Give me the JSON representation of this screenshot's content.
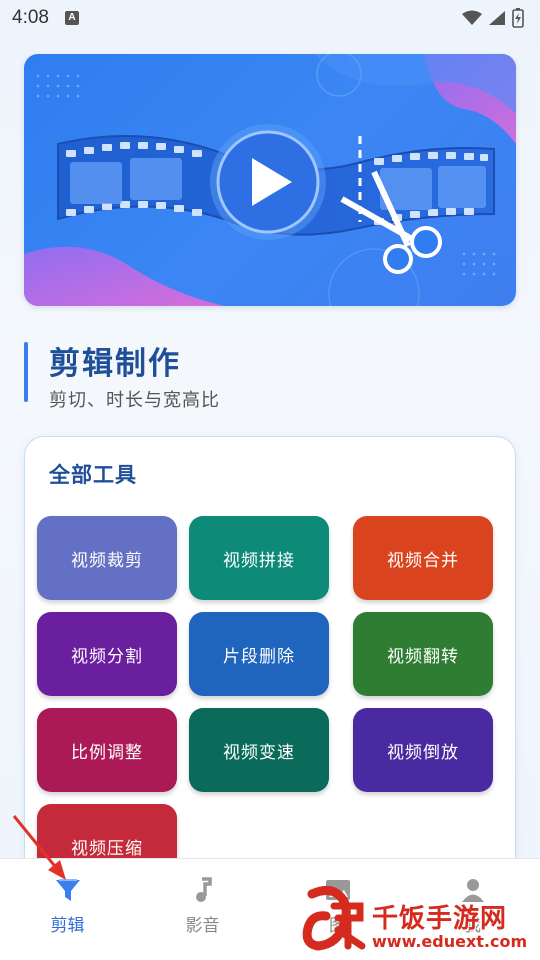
{
  "status_bar": {
    "time": "4:08",
    "notification_icon": "a-icon",
    "icons": [
      "wifi-icon",
      "signal-icon",
      "battery-charging-icon"
    ]
  },
  "banner": {
    "icons": [
      "play-icon",
      "film-strip-icon",
      "scissors-icon"
    ]
  },
  "section": {
    "title": "剪辑制作",
    "subtitle": "剪切、时长与宽高比"
  },
  "tools": {
    "title": "全部工具",
    "items": [
      {
        "label": "视频裁剪",
        "color": "#6370c4"
      },
      {
        "label": "视频拼接",
        "color": "#0d8a78"
      },
      {
        "label": "视频合并",
        "color": "#d9441e"
      },
      {
        "label": "视频分割",
        "color": "#6a1f9e"
      },
      {
        "label": "片段删除",
        "color": "#1f64bd"
      },
      {
        "label": "视频翻转",
        "color": "#2e7d32"
      },
      {
        "label": "比例调整",
        "color": "#ab1a56"
      },
      {
        "label": "视频变速",
        "color": "#0a6b5a"
      },
      {
        "label": "视频倒放",
        "color": "#4a2aa0"
      },
      {
        "label": "视频压缩",
        "color": "#c42a3a"
      }
    ]
  },
  "bottom_nav": {
    "items": [
      {
        "label": "剪辑",
        "icon": "funnel-icon",
        "active": true
      },
      {
        "label": "影音",
        "icon": "music-note-icon",
        "active": false
      },
      {
        "label": "图",
        "icon": "image-icon",
        "active": false
      },
      {
        "label": "我",
        "icon": "person-icon",
        "active": false
      }
    ]
  },
  "watermark": {
    "title": "千饭手游网",
    "url": "www.eduext.com"
  },
  "accent_color": "#3a7ff0",
  "annotation": {
    "icon": "red-arrow-icon"
  }
}
